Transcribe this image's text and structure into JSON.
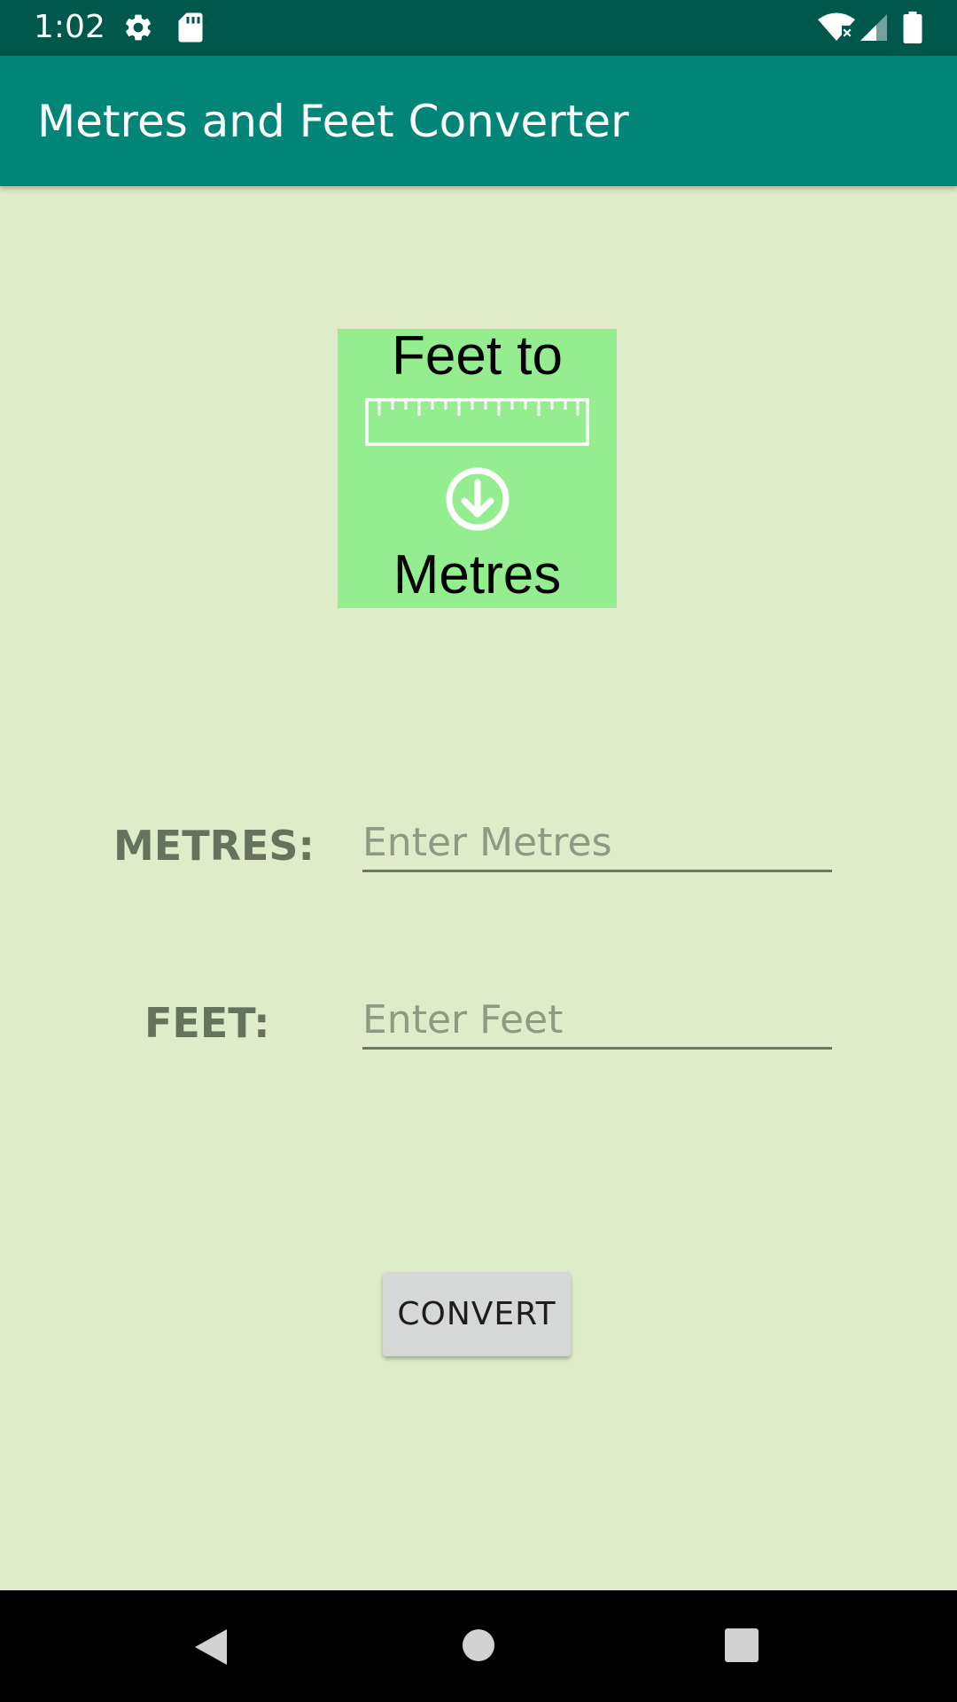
{
  "status_bar": {
    "time": "1:02",
    "icons": [
      "gear-icon",
      "sd-card-icon",
      "wifi-icon",
      "signal-icon",
      "battery-icon"
    ]
  },
  "app_bar": {
    "title": "Metres and Feet Converter",
    "color": "#008577"
  },
  "banner": {
    "top_text": "Feet to",
    "bottom_text": "Metres",
    "background": "#94ee90"
  },
  "form": {
    "metres_label": "METRES:",
    "metres_placeholder": "Enter Metres",
    "feet_label": "FEET:",
    "feet_placeholder": "Enter Feet"
  },
  "convert_button": {
    "label": "CONVERT"
  },
  "nav_bar": {
    "icons": [
      "back-icon",
      "home-icon",
      "recents-icon"
    ]
  },
  "colors": {
    "background": "#dfecc9",
    "status_bar": "#00574b",
    "label": "#66735c"
  }
}
